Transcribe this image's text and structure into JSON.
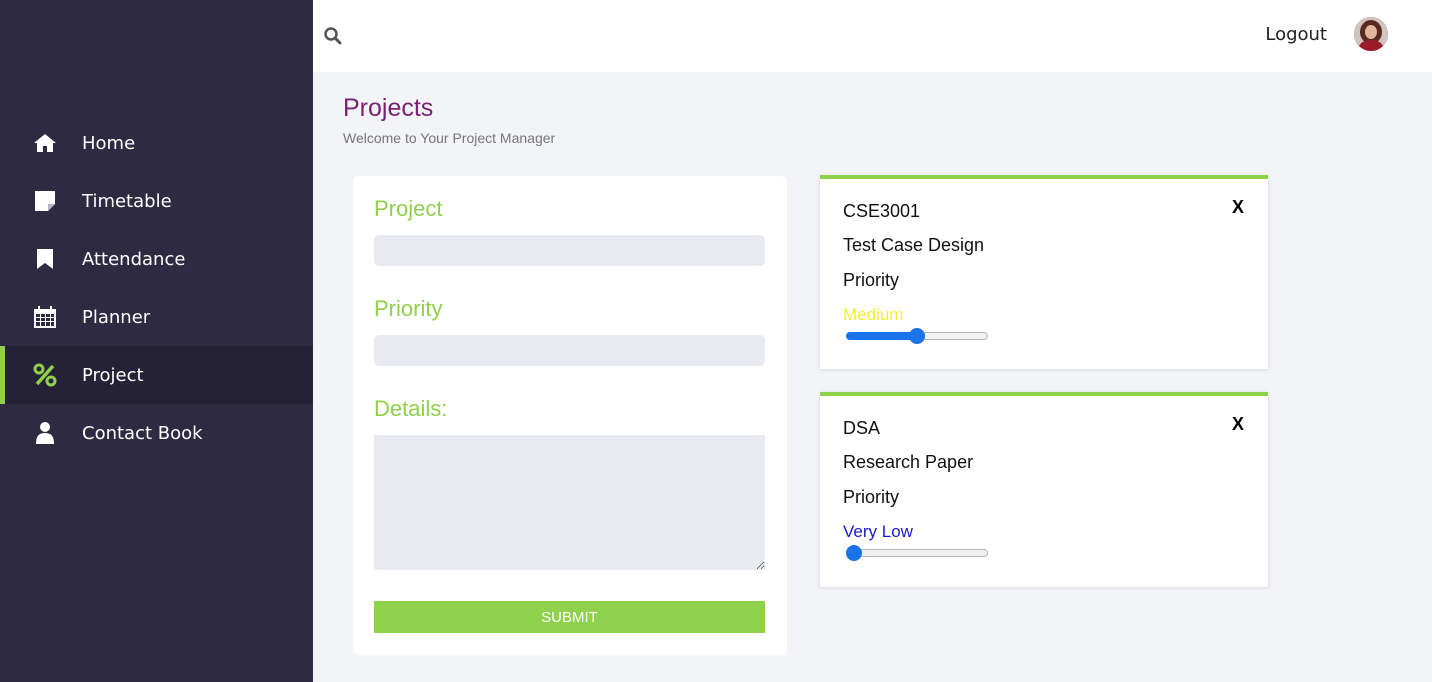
{
  "sidebar": {
    "items": [
      {
        "label": "Home",
        "icon": "home-icon"
      },
      {
        "label": "Timetable",
        "icon": "note-icon"
      },
      {
        "label": "Attendance",
        "icon": "bookmark-icon"
      },
      {
        "label": "Planner",
        "icon": "calendar-icon"
      },
      {
        "label": "Project",
        "icon": "percent-icon",
        "active": true
      },
      {
        "label": "Contact Book",
        "icon": "user-icon"
      }
    ]
  },
  "topbar": {
    "search_icon": "search-icon",
    "logout_label": "Logout",
    "avatar_icon": "avatar"
  },
  "header": {
    "title": "Projects",
    "subtitle": "Welcome to Your Project Manager"
  },
  "form": {
    "project_label": "Project",
    "project_value": "",
    "priority_label": "Priority",
    "priority_value": "",
    "details_label": "Details:",
    "details_value": "",
    "submit_label": "SUBMIT"
  },
  "projects": [
    {
      "code": "CSE3001",
      "title": "Test Case Design",
      "priority_label": "Priority",
      "priority_level": "Medium",
      "level_color": "#f2f22a",
      "slider_value": 0.5,
      "close_label": "X"
    },
    {
      "code": "DSA",
      "title": "Research Paper",
      "priority_label": "Priority",
      "priority_level": "Very Low",
      "level_color": "#1a1acc",
      "slider_value": 0.0,
      "close_label": "X"
    }
  ],
  "colors": {
    "accent": "#8fd14a",
    "sidebar": "#2d2a42",
    "title": "#7b2175",
    "slider": "#1a73e8"
  }
}
